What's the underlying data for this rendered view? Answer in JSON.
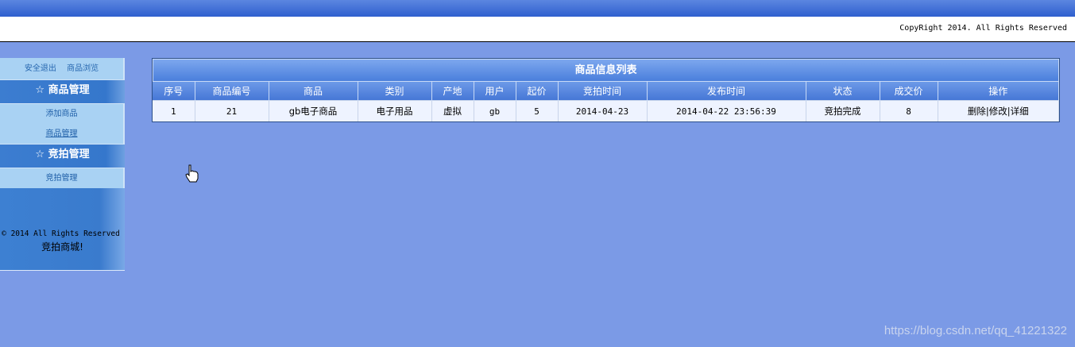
{
  "header": {
    "copyright": "CopyRight 2014. All Rights Reserved"
  },
  "sidebar": {
    "top_links": [
      "安全退出",
      "商品浏览"
    ],
    "sections": [
      {
        "title": "商品管理",
        "items": [
          "添加商品",
          "商品管理"
        ]
      },
      {
        "title": "竞拍管理",
        "items": [
          "竞拍管理"
        ]
      }
    ],
    "star": "☆",
    "footer_line1": "© 2014 All Rights Reserved",
    "footer_line2": "竞拍商城!"
  },
  "table": {
    "title": "商品信息列表",
    "columns": [
      "序号",
      "商品编号",
      "商品",
      "类别",
      "产地",
      "用户",
      "起价",
      "竞拍时间",
      "发布时间",
      "状态",
      "成交价",
      "操作"
    ],
    "rows": [
      {
        "idx": "1",
        "code": "21",
        "name": "gb电子商品",
        "category": "电子用品",
        "origin": "虚拟",
        "user": "gb",
        "start_price": "5",
        "auction_time": "2014-04-23",
        "publish_time": "2014-04-22 23:56:39",
        "status": "竞拍完成",
        "deal_price": "8",
        "actions": [
          "删除",
          "修改",
          "详细"
        ]
      }
    ]
  },
  "watermark": "https://blog.csdn.net/qq_41221322",
  "colors": {
    "background": "#7b9ae6",
    "header_bar": "#3c6fd6",
    "sidebar_head": "#3a7bcd"
  }
}
